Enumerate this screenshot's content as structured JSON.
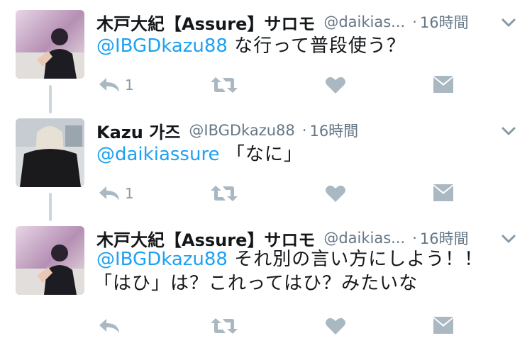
{
  "tweets": [
    {
      "author_name": "木戸大紀【Assure】サロモ",
      "handle": "@daikias...",
      "separator": "·",
      "time": "16時間",
      "mention": "@IBGDkazu88",
      "text": " な行って普段使う？",
      "text2": "",
      "reply_count": "1"
    },
    {
      "author_name": "Kazu 가즈",
      "handle": "@IBGDkazu88",
      "separator": "·",
      "time": "16時間",
      "mention": "@daikiassure",
      "text": " 「なに」",
      "text2": "",
      "reply_count": "1"
    },
    {
      "author_name": "木戸大紀【Assure】サロモ",
      "handle": "@daikias...",
      "separator": "·",
      "time": "16時間",
      "mention": "@IBGDkazu88",
      "text": " それ別の言い方にしよう！！",
      "text2": "「はひ」は？これってはひ？みたいな",
      "reply_count": ""
    }
  ],
  "icons": [
    "reply-icon",
    "retweet-icon",
    "like-icon",
    "message-icon",
    "chevron-down-icon"
  ],
  "colors": {
    "mention": "#1da1f2",
    "icon": "#aab8c2",
    "thread": "#ccd6dd"
  }
}
